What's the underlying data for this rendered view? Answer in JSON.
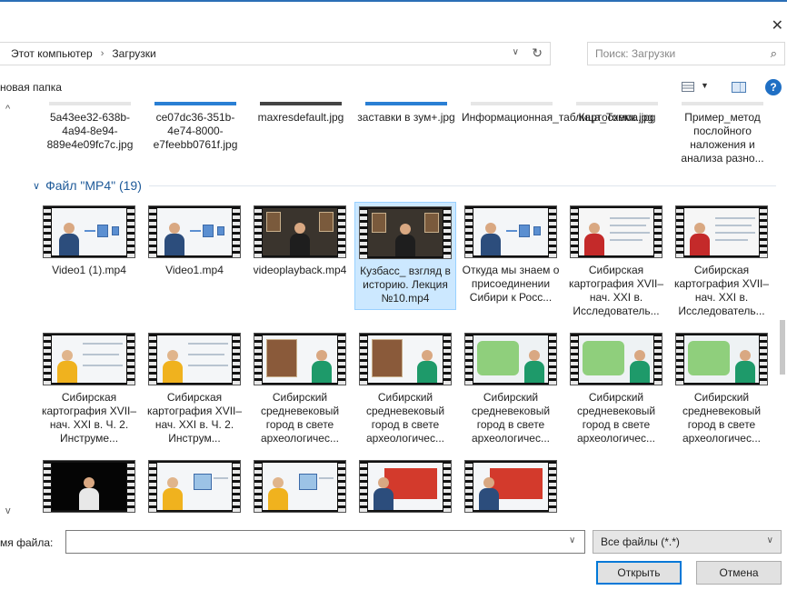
{
  "address": {
    "crumbs": [
      "Этот компьютер",
      "Загрузки"
    ]
  },
  "search": {
    "placeholder": "Поиск: Загрузки"
  },
  "toolbar": {
    "new_folder": "новая папка"
  },
  "top_row": [
    "5a43ee32-638b-4a94-8e94-889e4e09fc7c.jpg",
    "ce07dc36-351b-4e74-8000-e7feebb0761f.jpg",
    "maxresdefault.jpg",
    "заставки в зум+.jpg",
    "Информационная_таблица_Томск.jpg",
    "Картосхема.jpg",
    "Пример_метод послойного наложения и анализа разно..."
  ],
  "group": {
    "label": "Файл \"MP4\" (19)"
  },
  "videos": [
    "Video1 (1).mp4",
    "Video1.mp4",
    "videoplayback.mp4",
    "Кузбасс_ взгляд в историю. Лекция №10.mp4",
    "Откуда мы знаем о присоединении Сибири к Росс...",
    "Сибирская картография XVII–нач. XXI в. Исследователь...",
    "Сибирская картография XVII–нач. XXI в. Исследователь...",
    "Сибирская картография XVII–нач. XXI в. Ч. 2. Инструме...",
    "Сибирская картография XVII–нач. XXI в. Ч. 2. Инструм...",
    "Сибирский средневековый город в свете археологичес...",
    "Сибирский средневековый город в свете археологичес...",
    "Сибирский средневековый город в свете археологичес...",
    "Сибирский средневековый город в свете археологичес...",
    "Сибирский средневековый город в свете археологичес...",
    "",
    "",
    "",
    "",
    ""
  ],
  "selected_index": 3,
  "filename": {
    "label": "мя файла:",
    "value": ""
  },
  "filetype": {
    "value": "Все файлы (*.*)"
  },
  "buttons": {
    "open": "Открыть",
    "cancel": "Отмена"
  }
}
